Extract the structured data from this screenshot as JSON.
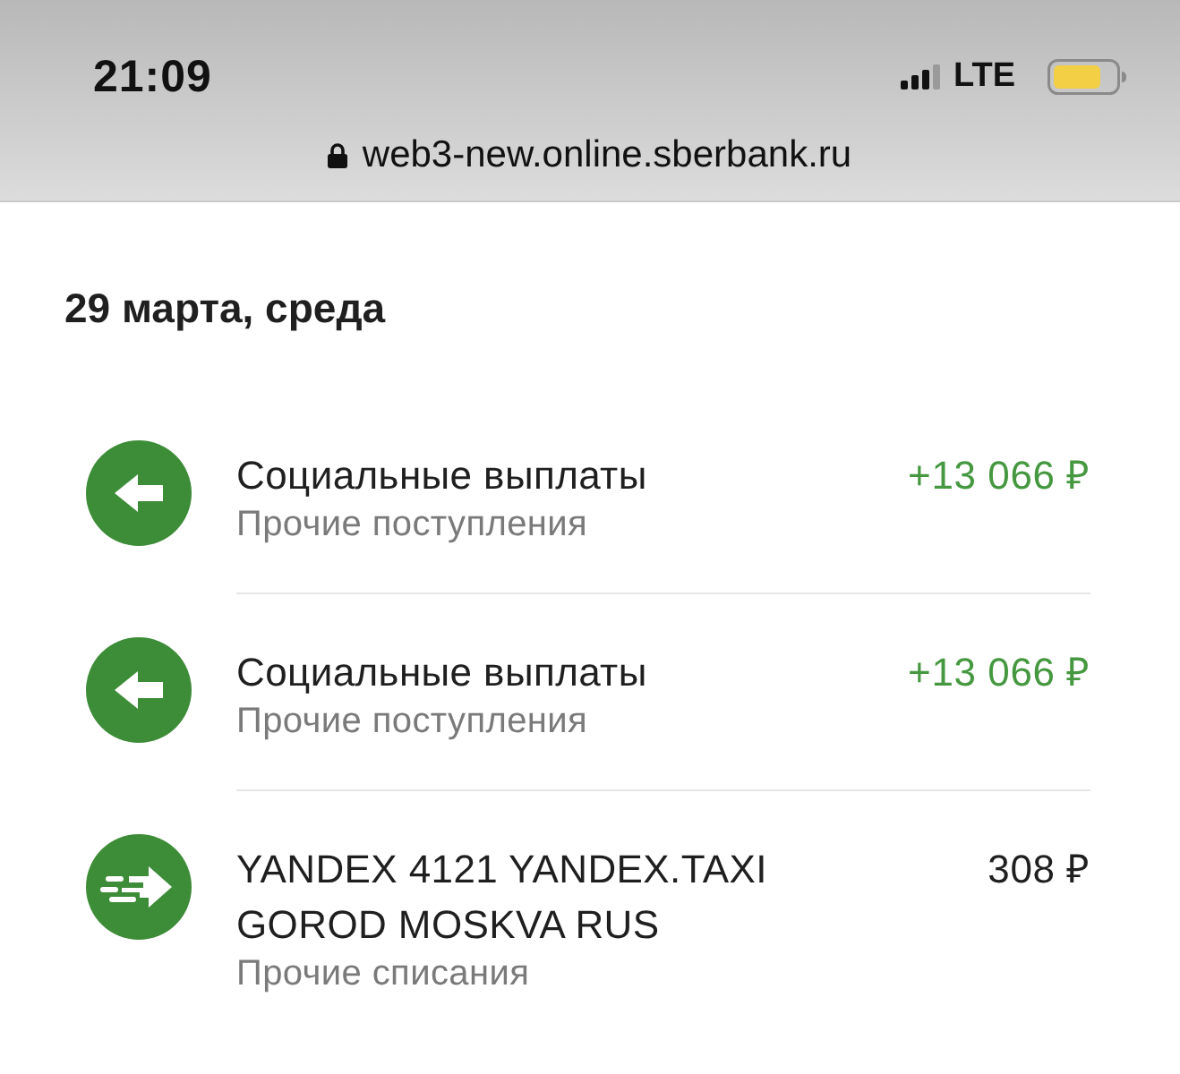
{
  "status_bar": {
    "time": "21:09",
    "network": "LTE"
  },
  "address_bar": {
    "url": "web3-new.online.sberbank.ru"
  },
  "date_header": "29 марта, среда",
  "transactions": [
    {
      "kind": "income",
      "title": "Социальные выплаты",
      "category": "Прочие поступления",
      "amount": "+13 066 ₽"
    },
    {
      "kind": "income",
      "title": "Социальные выплаты",
      "category": "Прочие поступления",
      "amount": "+13 066 ₽"
    },
    {
      "kind": "expense",
      "title": "YANDEX 4121 YANDEX.TAXI GOROD MOSKVA RUS",
      "category": "Прочие списания",
      "amount": "308 ₽"
    }
  ]
}
